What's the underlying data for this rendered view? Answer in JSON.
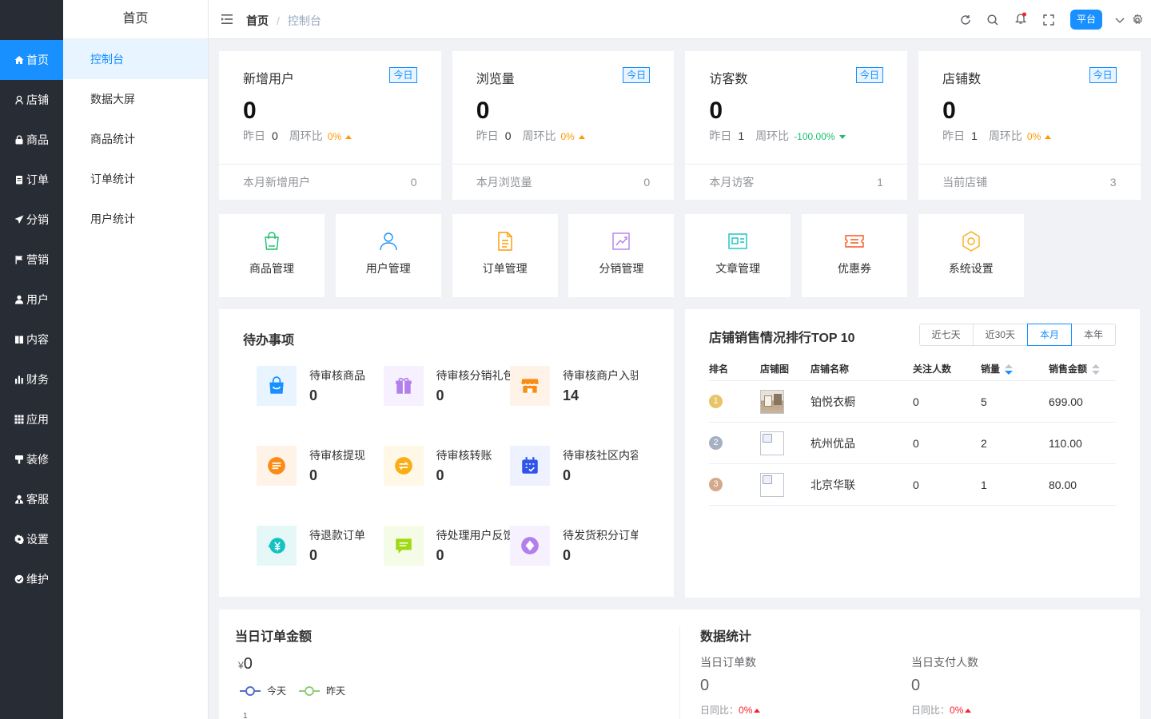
{
  "sidebar": {
    "items": [
      {
        "label": "首页",
        "icon": "home-icon",
        "active": true
      },
      {
        "label": "店铺",
        "icon": "shop-icon"
      },
      {
        "label": "商品",
        "icon": "lock-bag-icon"
      },
      {
        "label": "订单",
        "icon": "clipboard-icon"
      },
      {
        "label": "分销",
        "icon": "send-icon"
      },
      {
        "label": "营销",
        "icon": "flag-icon"
      },
      {
        "label": "用户",
        "icon": "user-icon"
      },
      {
        "label": "内容",
        "icon": "book-icon"
      },
      {
        "label": "财务",
        "icon": "bar-chart-icon"
      },
      {
        "label": "应用",
        "icon": "grid-icon"
      },
      {
        "label": "装修",
        "icon": "brush-icon"
      },
      {
        "label": "客服",
        "icon": "service-icon"
      },
      {
        "label": "设置",
        "icon": "gear-icon"
      },
      {
        "label": "维护",
        "icon": "maintenance-icon"
      }
    ]
  },
  "submenu": {
    "title": "首页",
    "items": [
      {
        "label": "控制台",
        "active": true
      },
      {
        "label": "数据大屏"
      },
      {
        "label": "商品统计"
      },
      {
        "label": "订单统计"
      },
      {
        "label": "用户统计"
      }
    ]
  },
  "header": {
    "breadcrumb_home": "首页",
    "breadcrumb_sep": "/",
    "breadcrumb_current": "控制台",
    "platform_label": "平台"
  },
  "stats": [
    {
      "title": "新增用户",
      "tag": "今日",
      "value": "0",
      "yesterday_label": "昨日",
      "yesterday": "0",
      "wow_label": "周环比",
      "wow": "0%",
      "trend": "up",
      "footer_label": "本月新增用户",
      "footer_value": "0"
    },
    {
      "title": "浏览量",
      "tag": "今日",
      "value": "0",
      "yesterday_label": "昨日",
      "yesterday": "0",
      "wow_label": "周环比",
      "wow": "0%",
      "trend": "up",
      "footer_label": "本月浏览量",
      "footer_value": "0"
    },
    {
      "title": "访客数",
      "tag": "今日",
      "value": "0",
      "yesterday_label": "昨日",
      "yesterday": "1",
      "wow_label": "周环比",
      "wow": "-100.00%",
      "trend": "down",
      "footer_label": "本月访客",
      "footer_value": "1"
    },
    {
      "title": "店铺数",
      "tag": "今日",
      "value": "0",
      "yesterday_label": "昨日",
      "yesterday": "1",
      "wow_label": "周环比",
      "wow": "0%",
      "trend": "up",
      "footer_label": "当前店铺",
      "footer_value": "3"
    }
  ],
  "quick_nav": [
    {
      "label": "商品管理",
      "icon": "shopping-bag-icon",
      "color": "#19be6b"
    },
    {
      "label": "用户管理",
      "icon": "user-outline-icon",
      "color": "#1890ff"
    },
    {
      "label": "订单管理",
      "icon": "document-icon",
      "color": "#ff9900"
    },
    {
      "label": "分销管理",
      "icon": "trend-chart-icon",
      "color": "#b37feb"
    },
    {
      "label": "文章管理",
      "icon": "article-card-icon",
      "color": "#13c2c2"
    },
    {
      "label": "优惠券",
      "icon": "coupon-icon",
      "color": "#fa541c"
    },
    {
      "label": "系统设置",
      "icon": "hexagon-settings-icon",
      "color": "#faad14"
    }
  ],
  "todo": {
    "title": "待办事项",
    "items": [
      {
        "label": "待审核商品",
        "count": "0",
        "icon": "bag-icon",
        "color": "#1890ff",
        "bg": "#e8f4ff"
      },
      {
        "label": "待审核分销礼包",
        "count": "0",
        "icon": "gift-icon",
        "color": "#b37feb",
        "bg": "#f6f0ff"
      },
      {
        "label": "待审核商户入驻",
        "count": "14",
        "icon": "store-icon",
        "color": "#fa8c16",
        "bg": "#fff3e8"
      },
      {
        "label": "待审核提现",
        "count": "0",
        "icon": "withdraw-icon",
        "color": "#fa8c16",
        "bg": "#fff3e8"
      },
      {
        "label": "待审核转账",
        "count": "0",
        "icon": "transfer-icon",
        "color": "#faad14",
        "bg": "#fff8e6"
      },
      {
        "label": "待审核社区内容",
        "count": "0",
        "icon": "calendar-check-icon",
        "color": "#2f54eb",
        "bg": "#eef1ff"
      },
      {
        "label": "待退款订单",
        "count": "0",
        "icon": "refund-icon",
        "color": "#13c2c2",
        "bg": "#e6f7f7"
      },
      {
        "label": "待处理用户反馈",
        "count": "0",
        "icon": "message-icon",
        "color": "#a0d911",
        "bg": "#f4fbe6"
      },
      {
        "label": "待发货积分订单",
        "count": "0",
        "icon": "diamond-icon",
        "color": "#b37feb",
        "bg": "#f6f0ff"
      }
    ]
  },
  "ranking": {
    "title": "店铺销售情况排行TOP 10",
    "ranges": [
      "近七天",
      "近30天",
      "本月",
      "本年"
    ],
    "active_range": "本月",
    "columns": [
      "排名",
      "店铺图",
      "店铺名称",
      "关注人数",
      "销量",
      "销售金额"
    ],
    "rows": [
      {
        "rank": "1",
        "name": "铂悦衣橱",
        "followers": "0",
        "sales": "5",
        "amount": "699.00",
        "badge": "#e8c36a",
        "thumb": "photo"
      },
      {
        "rank": "2",
        "name": "杭州优品",
        "followers": "0",
        "sales": "2",
        "amount": "110.00",
        "badge": "#a6b0c3",
        "thumb": "broken"
      },
      {
        "rank": "3",
        "name": "北京华联",
        "followers": "0",
        "sales": "1",
        "amount": "80.00",
        "badge": "#d4a98a",
        "thumb": "broken"
      }
    ]
  },
  "order_amount": {
    "title": "当日订单金额",
    "currency": "¥",
    "value": "0",
    "legend": [
      "今天",
      "昨天"
    ],
    "axis_tick": "1"
  },
  "data_stats": {
    "title": "数据统计",
    "items": [
      {
        "label": "当日订单数",
        "value": "0",
        "cmp_label": "日同比：",
        "cmp": "0%"
      },
      {
        "label": "当日支付人数",
        "value": "0",
        "cmp_label": "日同比：",
        "cmp": "0%"
      }
    ]
  }
}
